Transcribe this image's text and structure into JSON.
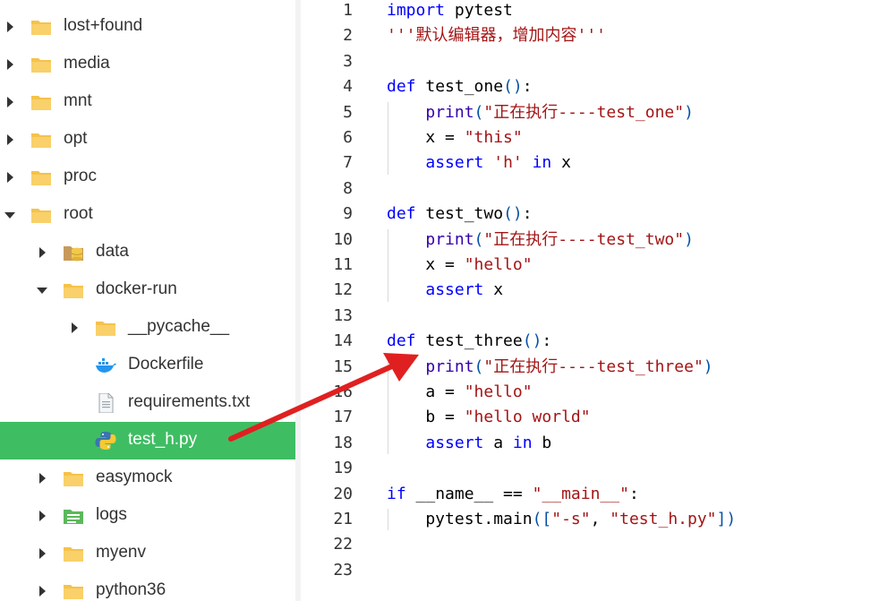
{
  "tree": {
    "items": [
      {
        "label": "lost+found",
        "icon": "folder-icon",
        "twisty": "collapsed",
        "depth": 0
      },
      {
        "label": "media",
        "icon": "folder-icon",
        "twisty": "collapsed",
        "depth": 0
      },
      {
        "label": "mnt",
        "icon": "folder-icon",
        "twisty": "collapsed",
        "depth": 0
      },
      {
        "label": "opt",
        "icon": "folder-icon",
        "twisty": "collapsed",
        "depth": 0
      },
      {
        "label": "proc",
        "icon": "folder-icon",
        "twisty": "collapsed",
        "depth": 0
      },
      {
        "label": "root",
        "icon": "folder-icon",
        "twisty": "expanded",
        "depth": 0
      },
      {
        "label": "data",
        "icon": "database-folder-icon",
        "twisty": "collapsed",
        "depth": 1
      },
      {
        "label": "docker-run",
        "icon": "folder-icon",
        "twisty": "expanded",
        "depth": 1
      },
      {
        "label": "__pycache__",
        "icon": "folder-icon",
        "twisty": "collapsed",
        "depth": 2
      },
      {
        "label": "Dockerfile",
        "icon": "docker-whale-icon",
        "twisty": "none",
        "depth": 2
      },
      {
        "label": "requirements.txt",
        "icon": "text-file-icon",
        "twisty": "none",
        "depth": 2
      },
      {
        "label": "test_h.py",
        "icon": "python-icon",
        "twisty": "none",
        "depth": 2,
        "selected": true
      },
      {
        "label": "easymock",
        "icon": "folder-icon",
        "twisty": "collapsed",
        "depth": 1
      },
      {
        "label": "logs",
        "icon": "log-folder-icon",
        "twisty": "collapsed",
        "depth": 1
      },
      {
        "label": "myenv",
        "icon": "folder-icon",
        "twisty": "collapsed",
        "depth": 1
      },
      {
        "label": "python36",
        "icon": "folder-icon",
        "twisty": "collapsed",
        "depth": 1
      }
    ]
  },
  "editor": {
    "lines": [
      {
        "n": "1",
        "t": [
          [
            "kw",
            "import"
          ],
          [
            "fn",
            " pytest"
          ]
        ]
      },
      {
        "n": "2",
        "t": [
          [
            "str",
            "'''默认编辑器，增加内容'''"
          ]
        ]
      },
      {
        "n": "3",
        "t": []
      },
      {
        "n": "4",
        "t": [
          [
            "kw",
            "def"
          ],
          [
            "fn",
            " test_one"
          ],
          [
            "pun",
            "()"
          ],
          [
            "fn",
            ":"
          ]
        ]
      },
      {
        "n": "5",
        "t": [
          [
            "fn",
            "    "
          ],
          [
            "bi",
            "print"
          ],
          [
            "pun",
            "("
          ],
          [
            "str",
            "\"正在执行----test_one\""
          ],
          [
            "pun",
            ")"
          ]
        ]
      },
      {
        "n": "6",
        "t": [
          [
            "fn",
            "    x = "
          ],
          [
            "str",
            "\"this\""
          ]
        ]
      },
      {
        "n": "7",
        "t": [
          [
            "fn",
            "    "
          ],
          [
            "kw",
            "assert"
          ],
          [
            "fn",
            " "
          ],
          [
            "str",
            "'h'"
          ],
          [
            "fn",
            " "
          ],
          [
            "kw",
            "in"
          ],
          [
            "fn",
            " x"
          ]
        ]
      },
      {
        "n": "8",
        "t": []
      },
      {
        "n": "9",
        "t": [
          [
            "kw",
            "def"
          ],
          [
            "fn",
            " test_two"
          ],
          [
            "pun",
            "()"
          ],
          [
            "fn",
            ":"
          ]
        ]
      },
      {
        "n": "10",
        "t": [
          [
            "fn",
            "    "
          ],
          [
            "bi",
            "print"
          ],
          [
            "pun",
            "("
          ],
          [
            "str",
            "\"正在执行----test_two\""
          ],
          [
            "pun",
            ")"
          ]
        ]
      },
      {
        "n": "11",
        "t": [
          [
            "fn",
            "    x = "
          ],
          [
            "str",
            "\"hello\""
          ]
        ]
      },
      {
        "n": "12",
        "t": [
          [
            "fn",
            "    "
          ],
          [
            "kw",
            "assert"
          ],
          [
            "fn",
            " x"
          ]
        ]
      },
      {
        "n": "13",
        "t": []
      },
      {
        "n": "14",
        "t": [
          [
            "kw",
            "def"
          ],
          [
            "fn",
            " test_three"
          ],
          [
            "pun",
            "()"
          ],
          [
            "fn",
            ":"
          ]
        ]
      },
      {
        "n": "15",
        "t": [
          [
            "fn",
            "    "
          ],
          [
            "bi",
            "print"
          ],
          [
            "pun",
            "("
          ],
          [
            "str",
            "\"正在执行----test_three\""
          ],
          [
            "pun",
            ")"
          ]
        ]
      },
      {
        "n": "16",
        "t": [
          [
            "fn",
            "    a = "
          ],
          [
            "str",
            "\"hello\""
          ]
        ]
      },
      {
        "n": "17",
        "t": [
          [
            "fn",
            "    b = "
          ],
          [
            "str",
            "\"hello world\""
          ]
        ]
      },
      {
        "n": "18",
        "t": [
          [
            "fn",
            "    "
          ],
          [
            "kw",
            "assert"
          ],
          [
            "fn",
            " a "
          ],
          [
            "kw",
            "in"
          ],
          [
            "fn",
            " b"
          ]
        ]
      },
      {
        "n": "19",
        "t": []
      },
      {
        "n": "20",
        "t": [
          [
            "kw",
            "if"
          ],
          [
            "fn",
            " __name__ == "
          ],
          [
            "str",
            "\"__main__\""
          ],
          [
            "fn",
            ":"
          ]
        ]
      },
      {
        "n": "21",
        "t": [
          [
            "fn",
            "    pytest.main"
          ],
          [
            "pun",
            "(["
          ],
          [
            "str",
            "\"-s\""
          ],
          [
            "fn",
            ", "
          ],
          [
            "str",
            "\"test_h.py\""
          ],
          [
            "pun",
            "])"
          ]
        ]
      },
      {
        "n": "22",
        "t": []
      },
      {
        "n": "23",
        "t": []
      }
    ]
  },
  "colors": {
    "selection": "#3fbd63",
    "keyword": "#0000ff",
    "string": "#a31515",
    "annotation_arrow": "#e02020"
  }
}
